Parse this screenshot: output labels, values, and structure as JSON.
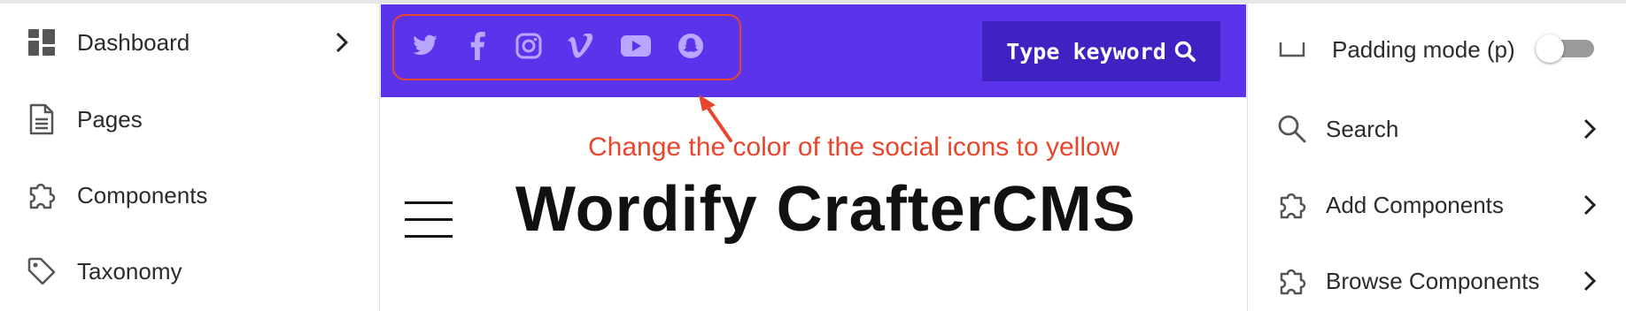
{
  "left_sidebar": {
    "items": [
      {
        "label": "Dashboard",
        "icon": "dashboard-icon",
        "has_chevron": true
      },
      {
        "label": "Pages",
        "icon": "page-icon"
      },
      {
        "label": "Components",
        "icon": "puzzle-icon"
      },
      {
        "label": "Taxonomy",
        "icon": "tag-icon"
      }
    ]
  },
  "preview": {
    "topbar_color": "#5b33ea",
    "social_icons": [
      "twitter-icon",
      "facebook-icon",
      "instagram-icon",
      "vimeo-icon",
      "youtube-icon",
      "snapchat-icon"
    ],
    "social_icon_color": "#b9a7ff",
    "search_label": "Type keyword",
    "annotation": "Change the color of the social icons to yellow",
    "annotation_color": "#e8462c",
    "site_title": "Wordify CrafterCMS"
  },
  "right_panel": {
    "padding_mode_label": "Padding mode (p)",
    "padding_mode_on": false,
    "items": [
      {
        "label": "Search",
        "icon": "search-icon"
      },
      {
        "label": "Add Components",
        "icon": "puzzle-icon"
      },
      {
        "label": "Browse Components",
        "icon": "puzzle-icon"
      }
    ]
  }
}
